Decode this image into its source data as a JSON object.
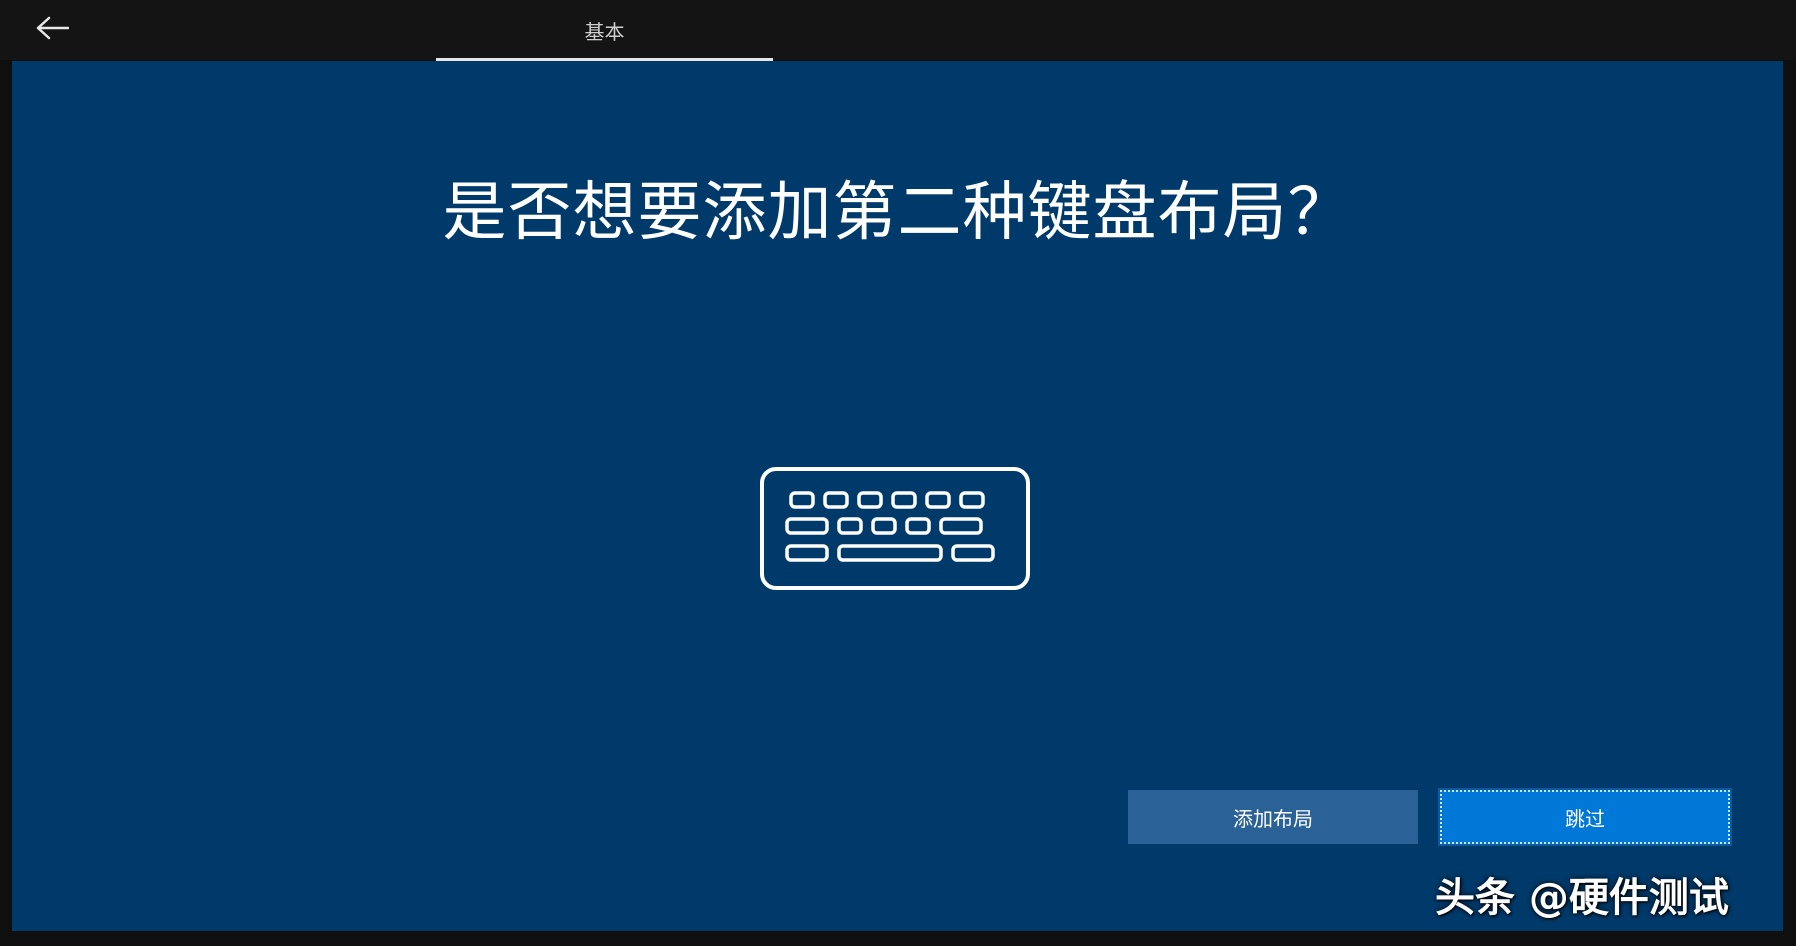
{
  "header": {
    "back_icon": "arrow-left-icon",
    "tab_label": "基本"
  },
  "main": {
    "title": "是否想要添加第二种键盘布局？",
    "illustration_icon": "keyboard-icon"
  },
  "actions": {
    "add_layout_label": "添加布局",
    "skip_label": "跳过"
  },
  "watermark": {
    "text": "头条 @硬件测试"
  },
  "colors": {
    "panel_background": "#003a6b",
    "add_button": "#2a6196",
    "skip_button": "#0078d7",
    "topbar": "#141414"
  }
}
